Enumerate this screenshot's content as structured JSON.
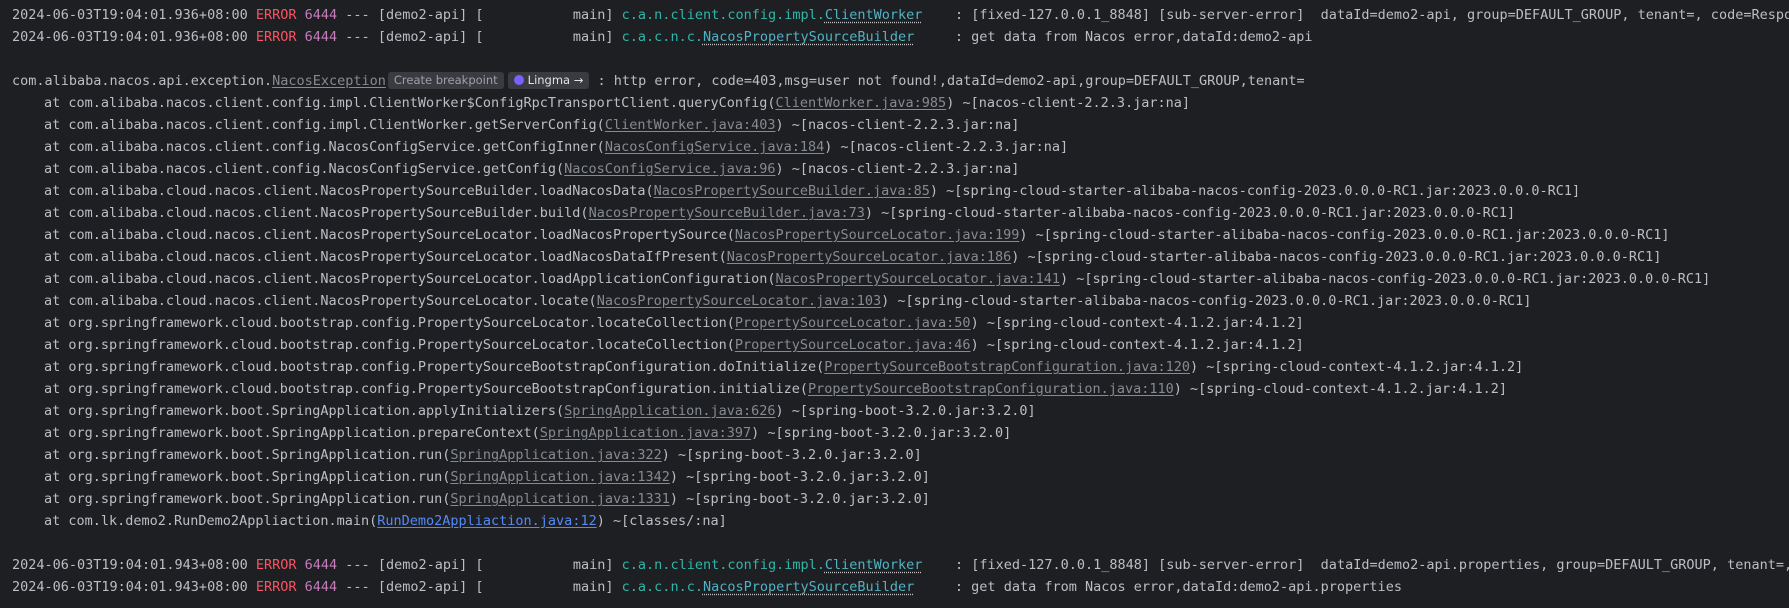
{
  "log": {
    "entries_top": [
      {
        "timestamp": "2024-06-03T19:04:01.936+08:00",
        "level": "ERROR",
        "pid": "6444",
        "sep": "---",
        "app": "[demo2-api]",
        "thread": "[           main]",
        "logger_pkg": "c.a.n.client.config.impl.",
        "logger_cls": "ClientWorker",
        "pad": "    ",
        "message": ": [fixed-127.0.0.1_8848] [sub-server-error]  dataId=demo2-api, group=DEFAULT_GROUP, tenant=, code=Response"
      },
      {
        "timestamp": "2024-06-03T19:04:01.936+08:00",
        "level": "ERROR",
        "pid": "6444",
        "sep": "---",
        "app": "[demo2-api]",
        "thread": "[           main]",
        "logger_pkg": "c.a.c.n.c.",
        "logger_cls": "NacosPropertySourceBuilder",
        "pad": "     ",
        "message": ": get data from Nacos error,dataId:demo2-api"
      }
    ],
    "exception": {
      "prefix": "com.alibaba.nacos.api.exception.",
      "class_link": "NacosException",
      "create_breakpoint": "Create breakpoint",
      "lingma": "Lingma →",
      "message": ": http error, code=403,msg=user not found!,dataId=demo2-api,group=DEFAULT_GROUP,tenant="
    },
    "stack": [
      {
        "at": "at com.alibaba.nacos.client.config.impl.ClientWorker$ConfigRpcTransportClient.queryConfig(",
        "link": "ClientWorker.java:985",
        "suffix": ") ~[nacos-client-2.2.3.jar:na]"
      },
      {
        "at": "at com.alibaba.nacos.client.config.impl.ClientWorker.getServerConfig(",
        "link": "ClientWorker.java:403",
        "suffix": ") ~[nacos-client-2.2.3.jar:na]"
      },
      {
        "at": "at com.alibaba.nacos.client.config.NacosConfigService.getConfigInner(",
        "link": "NacosConfigService.java:184",
        "suffix": ") ~[nacos-client-2.2.3.jar:na]"
      },
      {
        "at": "at com.alibaba.nacos.client.config.NacosConfigService.getConfig(",
        "link": "NacosConfigService.java:96",
        "suffix": ") ~[nacos-client-2.2.3.jar:na]"
      },
      {
        "at": "at com.alibaba.cloud.nacos.client.NacosPropertySourceBuilder.loadNacosData(",
        "link": "NacosPropertySourceBuilder.java:85",
        "suffix": ") ~[spring-cloud-starter-alibaba-nacos-config-2023.0.0.0-RC1.jar:2023.0.0.0-RC1]"
      },
      {
        "at": "at com.alibaba.cloud.nacos.client.NacosPropertySourceBuilder.build(",
        "link": "NacosPropertySourceBuilder.java:73",
        "suffix": ") ~[spring-cloud-starter-alibaba-nacos-config-2023.0.0.0-RC1.jar:2023.0.0.0-RC1]"
      },
      {
        "at": "at com.alibaba.cloud.nacos.client.NacosPropertySourceLocator.loadNacosPropertySource(",
        "link": "NacosPropertySourceLocator.java:199",
        "suffix": ") ~[spring-cloud-starter-alibaba-nacos-config-2023.0.0.0-RC1.jar:2023.0.0.0-RC1]"
      },
      {
        "at": "at com.alibaba.cloud.nacos.client.NacosPropertySourceLocator.loadNacosDataIfPresent(",
        "link": "NacosPropertySourceLocator.java:186",
        "suffix": ") ~[spring-cloud-starter-alibaba-nacos-config-2023.0.0.0-RC1.jar:2023.0.0.0-RC1]"
      },
      {
        "at": "at com.alibaba.cloud.nacos.client.NacosPropertySourceLocator.loadApplicationConfiguration(",
        "link": "NacosPropertySourceLocator.java:141",
        "suffix": ") ~[spring-cloud-starter-alibaba-nacos-config-2023.0.0.0-RC1.jar:2023.0.0.0-RC1]"
      },
      {
        "at": "at com.alibaba.cloud.nacos.client.NacosPropertySourceLocator.locate(",
        "link": "NacosPropertySourceLocator.java:103",
        "suffix": ") ~[spring-cloud-starter-alibaba-nacos-config-2023.0.0.0-RC1.jar:2023.0.0.0-RC1]"
      },
      {
        "at": "at org.springframework.cloud.bootstrap.config.PropertySourceLocator.locateCollection(",
        "link": "PropertySourceLocator.java:50",
        "suffix": ") ~[spring-cloud-context-4.1.2.jar:4.1.2]"
      },
      {
        "at": "at org.springframework.cloud.bootstrap.config.PropertySourceLocator.locateCollection(",
        "link": "PropertySourceLocator.java:46",
        "suffix": ") ~[spring-cloud-context-4.1.2.jar:4.1.2]"
      },
      {
        "at": "at org.springframework.cloud.bootstrap.config.PropertySourceBootstrapConfiguration.doInitialize(",
        "link": "PropertySourceBootstrapConfiguration.java:120",
        "suffix": ") ~[spring-cloud-context-4.1.2.jar:4.1.2]"
      },
      {
        "at": "at org.springframework.cloud.bootstrap.config.PropertySourceBootstrapConfiguration.initialize(",
        "link": "PropertySourceBootstrapConfiguration.java:110",
        "suffix": ") ~[spring-cloud-context-4.1.2.jar:4.1.2]"
      },
      {
        "at": "at org.springframework.boot.SpringApplication.applyInitializers(",
        "link": "SpringApplication.java:626",
        "suffix": ") ~[spring-boot-3.2.0.jar:3.2.0]"
      },
      {
        "at": "at org.springframework.boot.SpringApplication.prepareContext(",
        "link": "SpringApplication.java:397",
        "suffix": ") ~[spring-boot-3.2.0.jar:3.2.0]"
      },
      {
        "at": "at org.springframework.boot.SpringApplication.run(",
        "link": "SpringApplication.java:322",
        "suffix": ") ~[spring-boot-3.2.0.jar:3.2.0]"
      },
      {
        "at": "at org.springframework.boot.SpringApplication.run(",
        "link": "SpringApplication.java:1342",
        "suffix": ") ~[spring-boot-3.2.0.jar:3.2.0]"
      },
      {
        "at": "at org.springframework.boot.SpringApplication.run(",
        "link": "SpringApplication.java:1331",
        "suffix": ") ~[spring-boot-3.2.0.jar:3.2.0]"
      },
      {
        "at": "at com.lk.demo2.RunDemo2Appliaction.main(",
        "link": "RunDemo2Appliaction.java:12",
        "suffix": ") ~[classes/:na]",
        "main": true
      }
    ],
    "entries_bottom": [
      {
        "timestamp": "2024-06-03T19:04:01.943+08:00",
        "level": "ERROR",
        "pid": "6444",
        "sep": "---",
        "app": "[demo2-api]",
        "thread": "[           main]",
        "logger_pkg": "c.a.n.client.config.impl.",
        "logger_cls": "ClientWorker",
        "pad": "    ",
        "message": ": [fixed-127.0.0.1_8848] [sub-server-error]  dataId=demo2-api.properties, group=DEFAULT_GROUP, tenant=, co"
      },
      {
        "timestamp": "2024-06-03T19:04:01.943+08:00",
        "level": "ERROR",
        "pid": "6444",
        "sep": "---",
        "app": "[demo2-api]",
        "thread": "[           main]",
        "logger_pkg": "c.a.c.n.c.",
        "logger_cls": "NacosPropertySourceBuilder",
        "pad": "     ",
        "message": ": get data from Nacos error,dataId:demo2-api.properties"
      }
    ]
  }
}
